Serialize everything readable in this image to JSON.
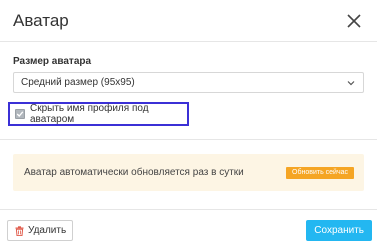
{
  "dialog": {
    "title": "Аватар"
  },
  "avatar_size": {
    "label": "Размер аватара",
    "selected": "Средний размер (95x95)"
  },
  "hide_name": {
    "label": "Скрыть имя профиля под аватаром",
    "checked": true
  },
  "notice": {
    "text": "Аватар автоматически обновляется раз в сутки",
    "button_label": "Обновить сейчас"
  },
  "footer": {
    "delete_label": "Удалить",
    "save_label": "Сохранить"
  },
  "colors": {
    "accent": "#23b7f1",
    "notice_bg": "#fdf5e4",
    "notice_button": "#f5a524",
    "highlight_border": "#3b30d6"
  }
}
